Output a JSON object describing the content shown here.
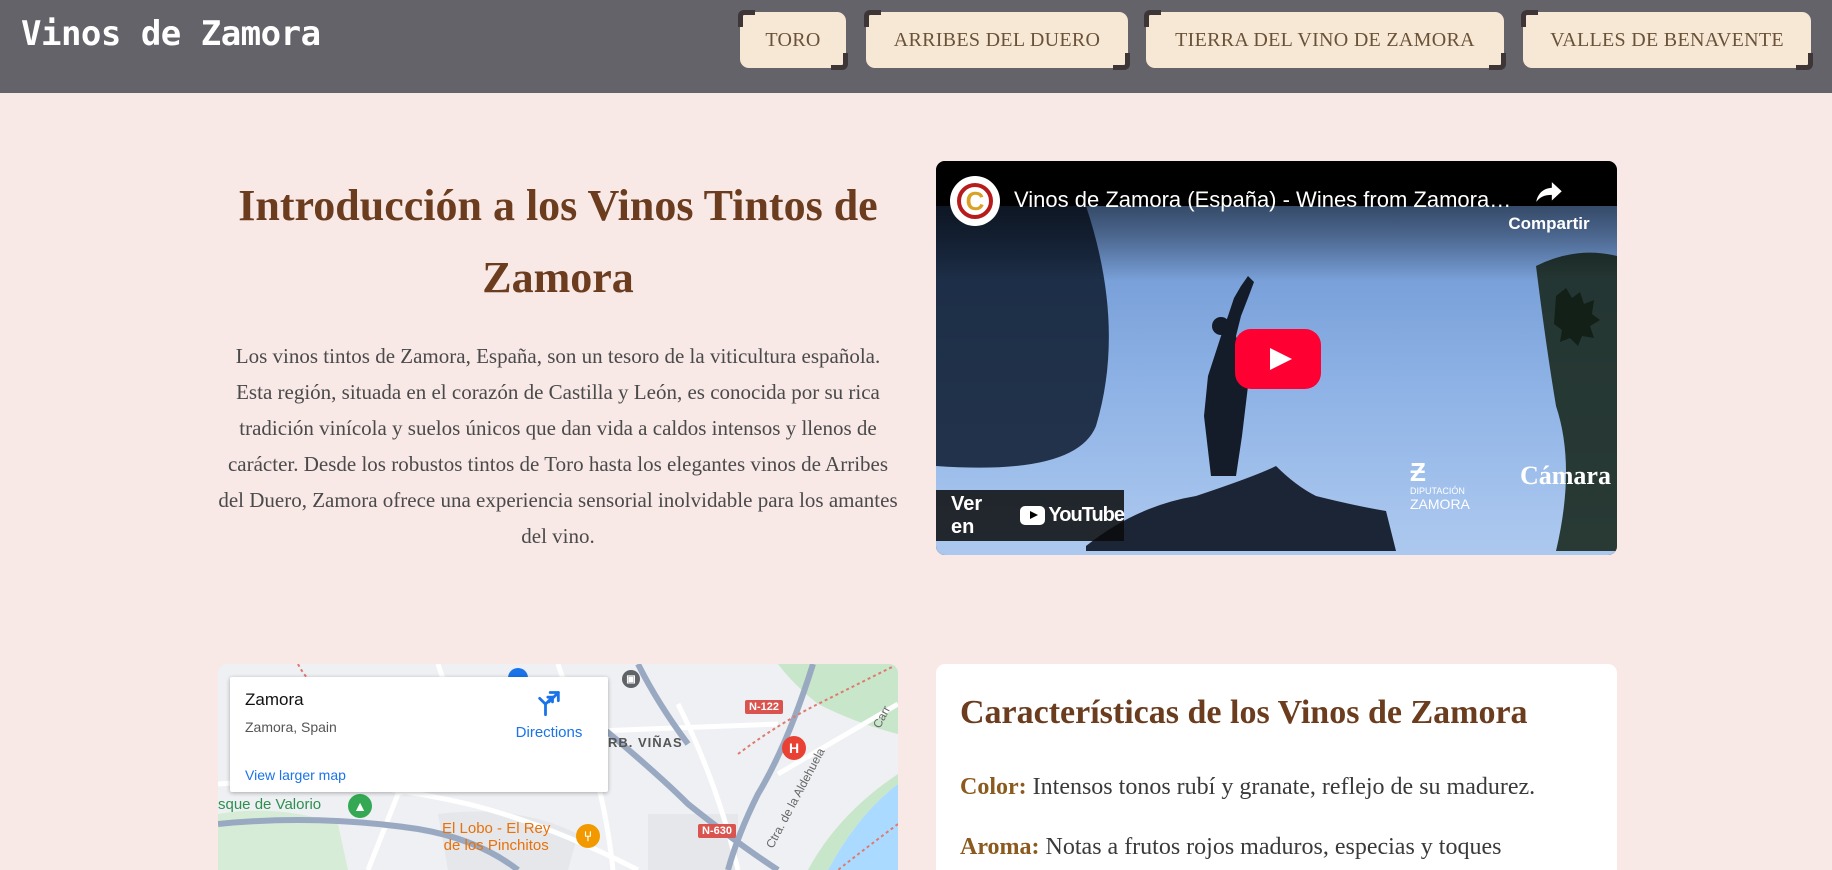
{
  "header": {
    "brand": "Vinos de Zamora",
    "nav": [
      "TORO",
      "ARRIBES DEL DUERO",
      "TIERRA DEL VINO DE ZAMORA",
      "VALLES DE BENAVENTE"
    ]
  },
  "intro": {
    "title": "Introducción a los Vinos Tintos de Zamora",
    "text": "Los vinos tintos de Zamora, España, son un tesoro de la viticultura española. Esta región, situada en el corazón de Castilla y León, es conocida por su rica tradición vinícola y suelos únicos que dan vida a caldos intensos y llenos de carácter. Desde los robustos tintos de Toro hasta los elegantes vinos de Arribes del Duero, Zamora ofrece una experiencia sensorial inolvidable para los amantes del vino."
  },
  "video": {
    "title": "Vinos de Zamora (España) - Wines from Zamora (Spain)",
    "channel_logo_letter": "C",
    "share_label": "Compartir",
    "watch_on_label": "Ver en",
    "youtube_word": "YouTube",
    "watermark_left_small": "DIPUTACIÓN",
    "watermark_left_big": "ZAMORA",
    "watermark_right": "Cámara"
  },
  "map": {
    "place_name": "Zamora",
    "place_address": "Zamora, Spain",
    "directions_label": "Directions",
    "larger_map_label": "View larger map",
    "labels": {
      "neighborhood": "RB. VIÑAS",
      "park": "sque de Valorio",
      "restaurant_line1": "El Lobo - El Rey",
      "restaurant_line2": "de los Pinchitos",
      "road_n122": "N-122",
      "road_n630": "N-630",
      "street_aldehuela": "Ctra. de la Aldehuela",
      "street_carr": "Carr"
    },
    "colors": {
      "water": "#aadaff",
      "park": "#c8e6c9",
      "road": "#ffffff",
      "major_road": "#9aa9c2",
      "highway_badge": "#d9534f"
    }
  },
  "features": {
    "title": "Características de los Vinos de Zamora",
    "items": [
      {
        "key": "Color:",
        "value": "Intensos tonos rubí y granate, reflejo de su madurez."
      },
      {
        "key": "Aroma:",
        "value": "Notas a frutos rojos maduros, especias y toques"
      }
    ]
  }
}
